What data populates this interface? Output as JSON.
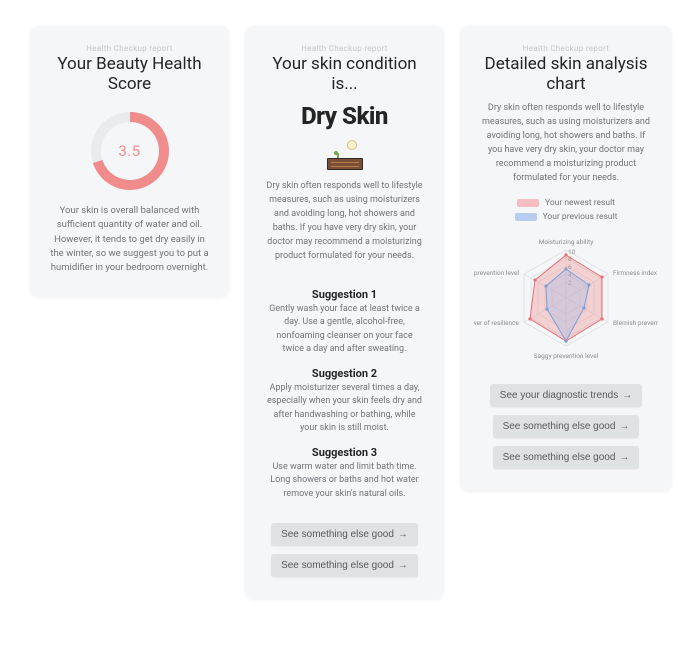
{
  "card1": {
    "eyebrow": "Health Checkup report",
    "title": "Your Beauty Health Score",
    "score": "3.5",
    "score_max": 5,
    "donut_fill_deg": 252,
    "description": "Your skin is overall balanced with sufficient quantity of water and oil. However, it tends to get dry easily in the winter, so we suggest you to put a humidifier in your bedroom overnight."
  },
  "card2": {
    "eyebrow": "Health Checkup report",
    "title": "Your skin condition is...",
    "condition": "Dry Skin",
    "icon": "dry-soil-icon",
    "description": "Dry skin often responds well to lifestyle measures, such as using moisturizers and avoiding long, hot showers and baths. If you have very dry skin, your doctor may recommend a moisturizing product formulated for your needs.",
    "suggestions": [
      {
        "heading": "Suggestion 1",
        "text": "Gently wash your face at least twice a day. Use a gentle, alcohol-free, nonfoaming cleanser on your face twice a day and after sweating."
      },
      {
        "heading": "Suggestion 2",
        "text": "Apply moisturizer several times a day, especially when your skin feels dry and after handwashing or bathing, while your skin is still moist."
      },
      {
        "heading": "Suggestion 3",
        "text": "Use warm water and limit bath time. Long showers or baths and hot water remove your skin's natural oils."
      }
    ],
    "buttons": [
      "See something else good",
      "See something else good"
    ]
  },
  "card3": {
    "eyebrow": "Health Checkup report",
    "title": "Detailed skin analysis chart",
    "description": "Dry skin often responds well to lifestyle measures, such as using moisturizers and avoiding long, hot showers and baths. If you have very dry skin, your doctor may recommend a moisturizing product formulated for your needs.",
    "legend": [
      "Your newest result",
      "Your previous result"
    ],
    "buttons": [
      "See your diagnostic trends",
      "See something else good",
      "See something else good"
    ]
  },
  "chart_data": {
    "type": "radar",
    "axes": [
      "Moisturizing ability",
      "Firmness index",
      "Blemish prevention",
      "Saggy prevention level",
      "Power of resilience",
      "Wrinkles prevention level"
    ],
    "scale": {
      "min": 0,
      "max": 10,
      "ticks": [
        2,
        4,
        6,
        8,
        10
      ]
    },
    "series": [
      {
        "name": "Your newest result",
        "color": "#f08c8c",
        "values": [
          9,
          9,
          9,
          9,
          9,
          8
        ]
      },
      {
        "name": "Your previous result",
        "color": "#9bb8e8",
        "values": [
          6,
          6,
          4,
          9,
          5,
          5
        ]
      }
    ]
  },
  "colors": {
    "accent_pink": "#f08c8c",
    "accent_blue": "#9bb8e8",
    "card_bg": "#f5f6f8",
    "button_bg": "#dfe2e5"
  }
}
